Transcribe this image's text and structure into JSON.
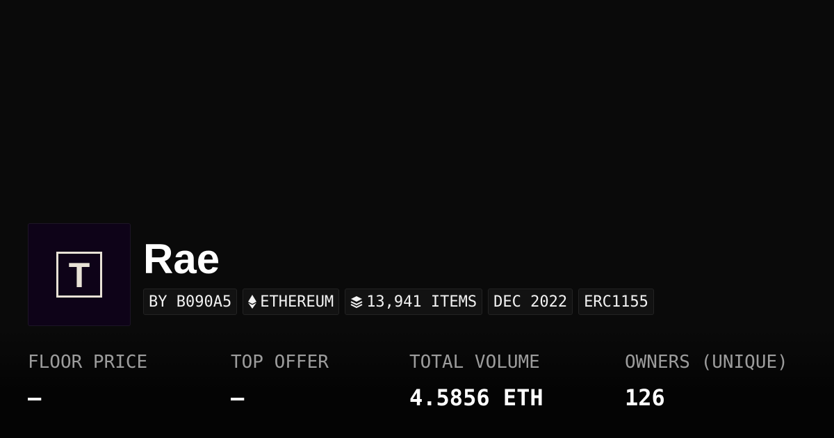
{
  "collection": {
    "logo_letter": "T",
    "name": "Rae",
    "badges": [
      {
        "icon": "none",
        "label": "BY B090A5"
      },
      {
        "icon": "ethereum-icon",
        "label": "ETHEREUM"
      },
      {
        "icon": "layers-icon",
        "label": "13,941 ITEMS"
      },
      {
        "icon": "none",
        "label": "DEC 2022"
      },
      {
        "icon": "none",
        "label": "ERC1155"
      }
    ]
  },
  "stats": [
    {
      "label": "FLOOR PRICE",
      "value": "–"
    },
    {
      "label": "TOP OFFER",
      "value": "–"
    },
    {
      "label": "TOTAL VOLUME",
      "value": "4.5856 ETH"
    },
    {
      "label": "OWNERS (UNIQUE)",
      "value": "126"
    }
  ],
  "colors": {
    "background": "#0a0a0a",
    "logo_background": "#0e0318",
    "logo_mark": "#e8e2d6",
    "label_gray": "#9c9c9c",
    "text_white": "#ffffff"
  }
}
